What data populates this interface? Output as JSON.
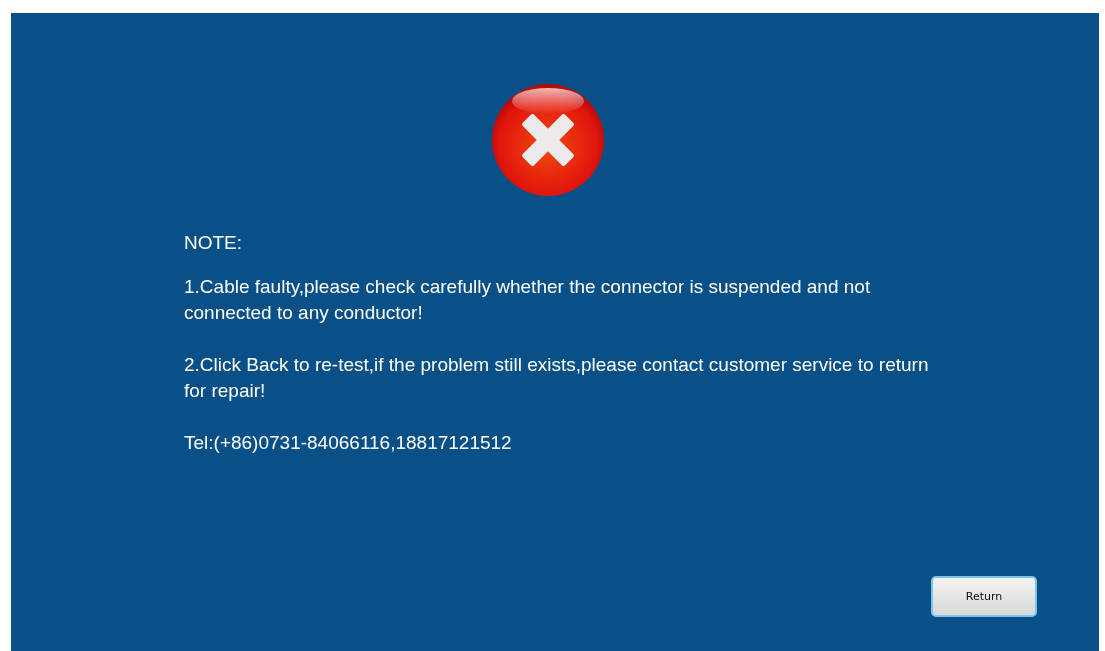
{
  "note": {
    "heading": "NOTE:",
    "paragraphs": [
      "1.Cable faulty,please check carefully whether the connector is suspended and not connected to any conductor!",
      "2.Click Back to re-test,if the problem still exists,please contact customer service to return for repair!",
      "Tel:(+86)0731-84066116,18817121512"
    ]
  },
  "buttons": [
    {
      "label": "Return"
    }
  ]
}
